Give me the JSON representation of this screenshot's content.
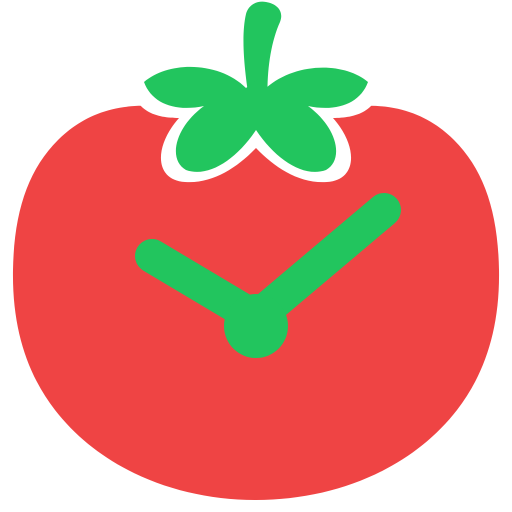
{
  "icon": {
    "name": "tomato-clock-icon",
    "colors": {
      "tomato_body": "#EF4444",
      "leaves_and_stem": "#22C55E",
      "clock_hands": "#22C55E",
      "background": "#FFFFFF"
    }
  }
}
